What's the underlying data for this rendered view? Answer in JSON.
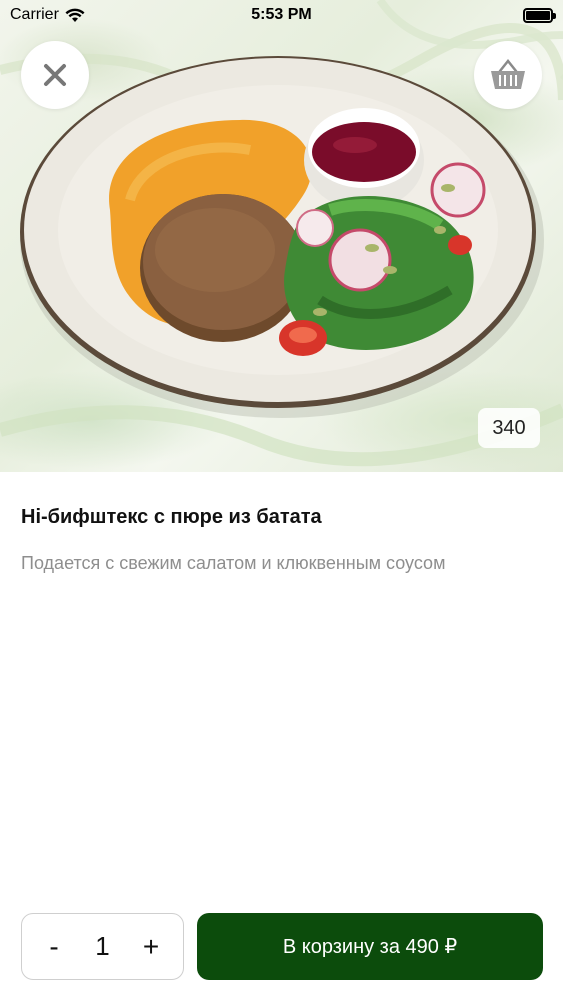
{
  "status_bar": {
    "carrier": "Carrier",
    "time": "5:53 PM"
  },
  "header": {
    "close_icon": "close-icon",
    "basket_icon": "basket-icon"
  },
  "product": {
    "weight": "340",
    "title": "Hi-бифштекс с пюре из батата",
    "description": "Подается с свежим салатом и клюквенным соусом",
    "image": "product-photo"
  },
  "cart": {
    "decrement_label": "-",
    "quantity": "1",
    "increment_label": "+",
    "add_button_label": "В корзину за 490 ₽"
  },
  "colors": {
    "primary": "#0c4c0c",
    "muted_text": "#8e8e8e"
  }
}
